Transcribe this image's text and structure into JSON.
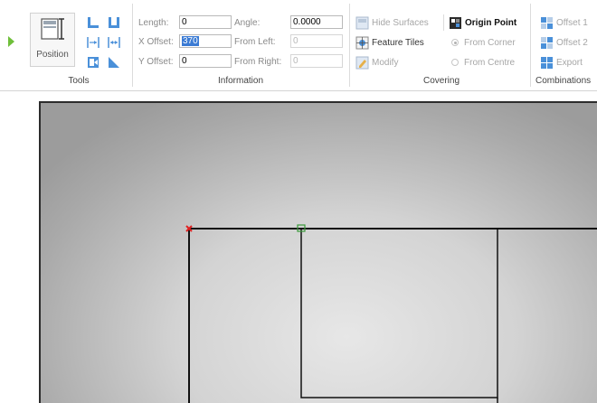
{
  "ribbon": {
    "tools": {
      "group_label": "Tools",
      "position_button": "Position"
    },
    "information": {
      "group_label": "Information",
      "length_label": "Length:",
      "length_value": "0",
      "x_offset_label": "X Offset:",
      "x_offset_value": "370",
      "y_offset_label": "Y Offset:",
      "y_offset_value": "0",
      "angle_label": "Angle:",
      "angle_value": "0.0000",
      "from_left_label": "From Left:",
      "from_left_value": "0",
      "from_right_label": "From Right:",
      "from_right_value": "0"
    },
    "covering": {
      "group_label": "Covering",
      "hide_surfaces": "Hide Surfaces",
      "feature_tiles": "Feature Tiles",
      "modify": "Modify",
      "origin_point": "Origin Point",
      "from_corner": "From Corner",
      "from_centre": "From Centre"
    },
    "combinations": {
      "group_label": "Combinations",
      "offset1": "Offset 1",
      "offset2": "Offset 2",
      "export": "Export"
    }
  },
  "colors": {
    "accent_green": "#6fbf3a",
    "selection_blue": "#3b7bd4",
    "origin_marker_red": "#e02020"
  }
}
